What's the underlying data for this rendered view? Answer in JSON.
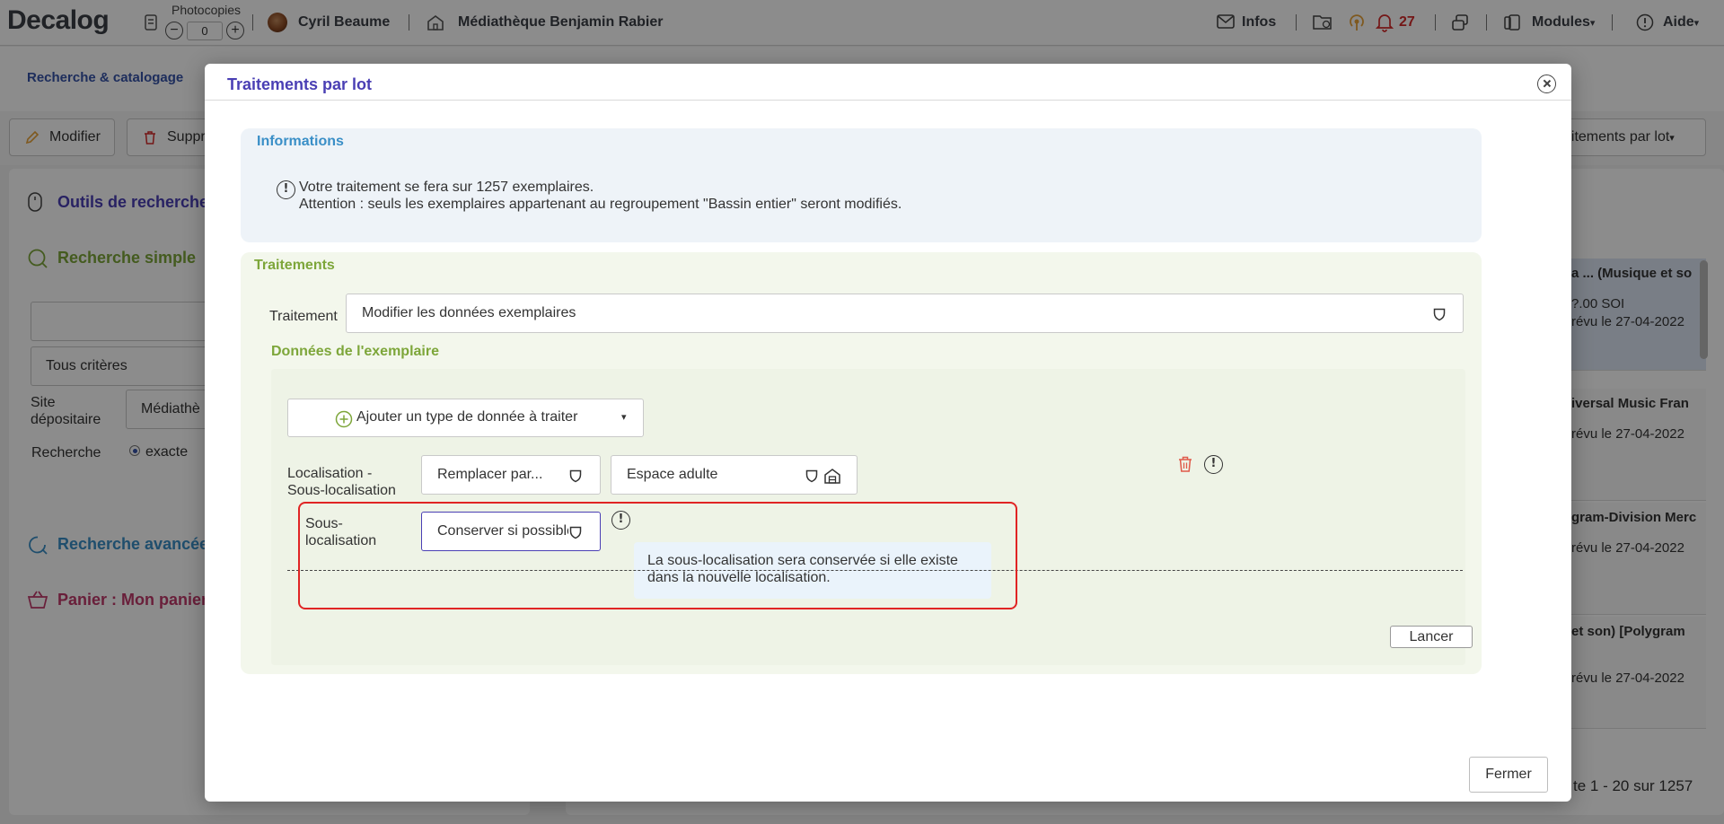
{
  "topbar": {
    "logo": "Decalog",
    "photocopies_label": "Photocopies",
    "photocopies_count": "0",
    "user_name": "Cyril Beaume",
    "library_name": "Médiathèque Benjamin Rabier",
    "infos_label": "Infos",
    "notifications_count": "27",
    "modules_label": "Modules",
    "aide_label": "Aide"
  },
  "background": {
    "breadcrumb": "Recherche & catalogage",
    "toolbar": {
      "modifier_label": "Modifier",
      "supprimer_label": "Suppr",
      "traitements_label": "aitements par lot"
    },
    "left_panel": {
      "outils_title": "Outils de recherche",
      "simple_title": "Recherche simple",
      "criteria_select": "Tous critères",
      "site_label": "Site dépositaire",
      "site_value": "Médiathè",
      "recherche_label": "Recherche",
      "exacte_label": "exacte",
      "avancee_title": "Recherche avancée",
      "panier_title": "Panier : Mon panier"
    },
    "results": [
      {
        "title": "a ... (Musique et so",
        "line2": "?.00 SOI",
        "line3": "révu le 27-04-2022"
      },
      {
        "title": "iversal Music Fran",
        "line2": "révu le 27-04-2022",
        "line3": ""
      },
      {
        "title": "gram-Division Merc",
        "line2": "révu le 27-04-2022",
        "line3": ""
      },
      {
        "title": "et son) [Polygram",
        "line2": "révu le 27-04-2022",
        "line3": ""
      }
    ],
    "pagination": "te 1 - 20 sur 1257"
  },
  "modal": {
    "title": "Traitements par lot",
    "informations": {
      "title": "Informations",
      "line1": "Votre traitement se fera sur 1257 exemplaires.",
      "line2": "Attention : seuls les exemplaires appartenant au regroupement \"Bassin entier\" seront modifiés."
    },
    "traitements": {
      "title": "Traitements",
      "traitement_label": "Traitement",
      "traitement_value": "Modifier les données exemplaires",
      "donnees_title": "Données de l'exemplaire",
      "add_type_label": "Ajouter un type de donnée à traiter",
      "localisation_label": "Localisation - Sous-localisation",
      "localisation_action": "Remplacer par...",
      "localisation_value": "Espace adulte",
      "sous_localisation_label": "Sous-localisation",
      "sous_localisation_value": "Conserver si possible",
      "tooltip_text": "La sous-localisation sera conservée si elle existe dans la nouvelle localisation.",
      "lancer_label": "Lancer"
    },
    "fermer_label": "Fermer"
  },
  "colors": {
    "modal_title": "#4a3fb4",
    "info_title": "#3a8fc7",
    "traitements_title": "#7da63a",
    "highlight_frame": "#e02424",
    "notification": "#d32b2b"
  }
}
